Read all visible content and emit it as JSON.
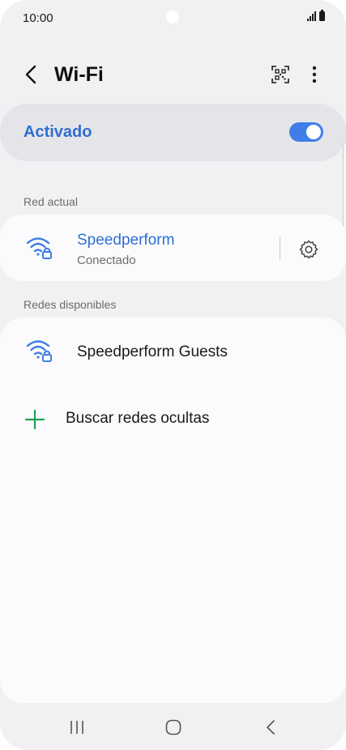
{
  "status_bar": {
    "time": "10:00"
  },
  "header": {
    "title": "Wi-Fi",
    "back_icon": "chevron-left-icon",
    "qr_icon": "qr-code-scan-icon",
    "more_icon": "more-vertical-icon"
  },
  "master_toggle": {
    "label": "Activado",
    "enabled": true,
    "accent_color": "#3f7ee8"
  },
  "current_network": {
    "section_label": "Red actual",
    "name": "Speedperform",
    "status": "Conectado",
    "icon": "wifi-lock-icon",
    "settings_icon": "gear-icon"
  },
  "available_networks": {
    "section_label": "Redes disponibles",
    "items": [
      {
        "name": "Speedperform Guests",
        "icon": "wifi-lock-icon"
      }
    ],
    "add_label": "Buscar redes ocultas",
    "add_icon": "plus-icon",
    "add_color": "#1fa05a"
  },
  "nav_bar": {
    "recents_icon": "recents-icon",
    "home_icon": "home-icon",
    "back_icon": "back-icon"
  }
}
